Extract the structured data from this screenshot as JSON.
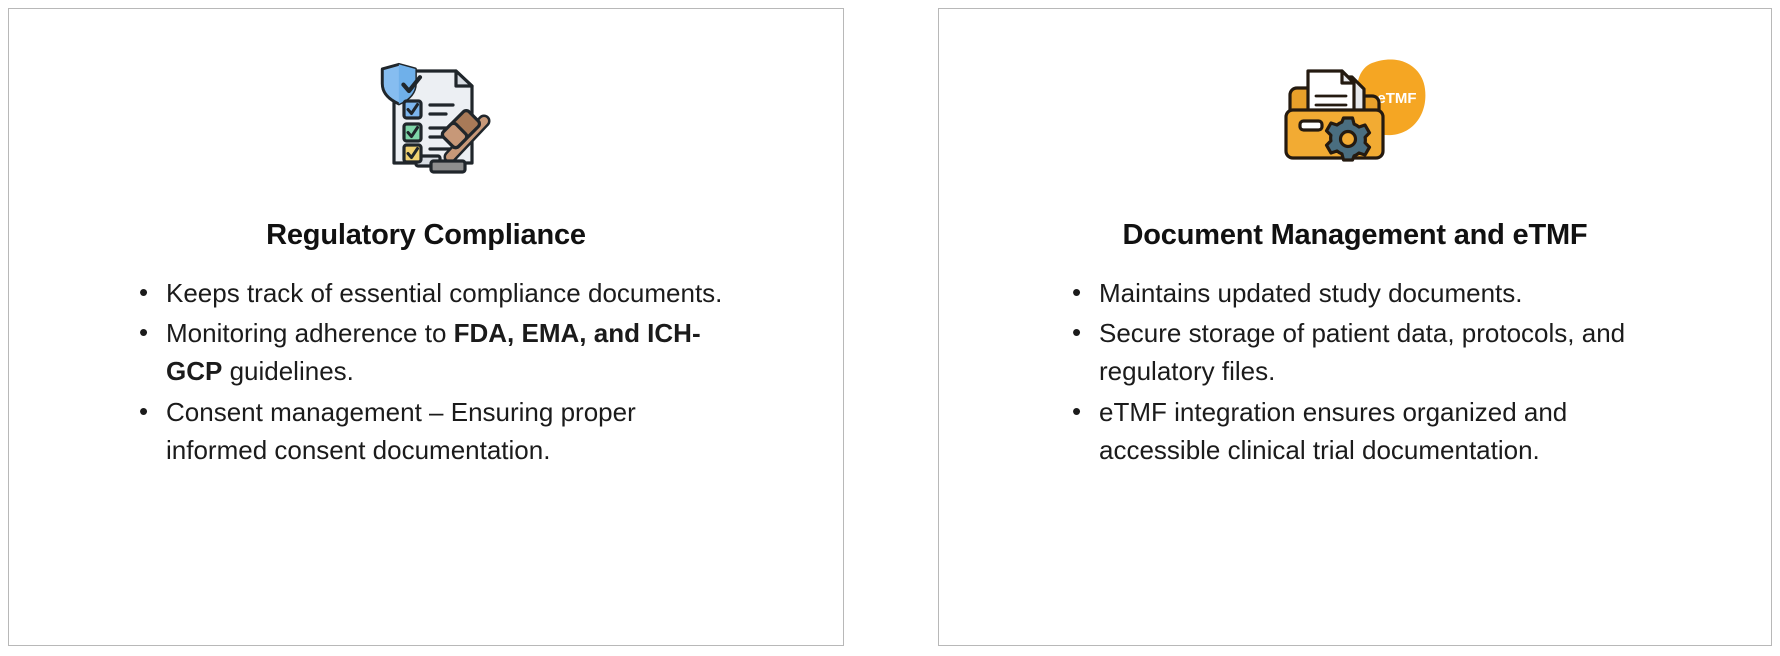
{
  "page": {
    "background_color": "#ffffff",
    "card_border_color": "#b8b8b8",
    "text_color": "#1b1b1b",
    "title_color": "#111111"
  },
  "cards": [
    {
      "id": "regulatory-compliance",
      "icon": {
        "name": "compliance-clipboard-shield-gavel-icon",
        "label": "Clipboard with shield, checkboxes and gavel",
        "colors": {
          "shield_fill": "#86bdf0",
          "shield_highlight": "#b9dcfb",
          "paper": "#eceff3",
          "paper_shade": "#d8dde3",
          "check_blue": "#7cb6ee",
          "check_green": "#7fd6a9",
          "check_yellow": "#f2d271",
          "gavel_wood": "#c79878",
          "gavel_wood_dark": "#a87a58",
          "outline": "#20262b"
        }
      },
      "title": "Regulatory Compliance",
      "bullets": [
        {
          "parts": [
            {
              "text": "Keeps track of essential compliance documents.",
              "bold": false
            }
          ]
        },
        {
          "parts": [
            {
              "text": "Monitoring adherence to ",
              "bold": false
            },
            {
              "text": "FDA, EMA, and ICH-GCP",
              "bold": true
            },
            {
              "text": " guidelines.",
              "bold": false
            }
          ]
        },
        {
          "parts": [
            {
              "text": "Consent management – Ensuring proper informed consent documentation.",
              "bold": false
            }
          ]
        }
      ]
    },
    {
      "id": "document-management-etmf",
      "icon": {
        "name": "etmf-folder-document-gear-icon",
        "label": "Orange folder with document, gear and eTMF badge",
        "badge_text": "eTMF",
        "colors": {
          "blob": "#f5a623",
          "folder": "#f0a830",
          "folder_front": "#f2ab33",
          "folder_back": "#e8a02a",
          "paper": "#ffffff",
          "paper_shade": "#e7e9ec",
          "paper_lines": "#2a2f34",
          "gear": "#4a6e80",
          "gear_dark": "#3b5a69",
          "badge_text_color": "#ffffff",
          "outline": "#241a10"
        }
      },
      "title": "Document Management and eTMF",
      "bullets": [
        {
          "parts": [
            {
              "text": "Maintains updated study documents.",
              "bold": false
            }
          ]
        },
        {
          "parts": [
            {
              "text": "Secure storage of patient data, protocols, and regulatory files.",
              "bold": false
            }
          ]
        },
        {
          "parts": [
            {
              "text": "eTMF integration ensures organized and accessible clinical trial documentation.",
              "bold": false
            }
          ]
        }
      ]
    }
  ]
}
